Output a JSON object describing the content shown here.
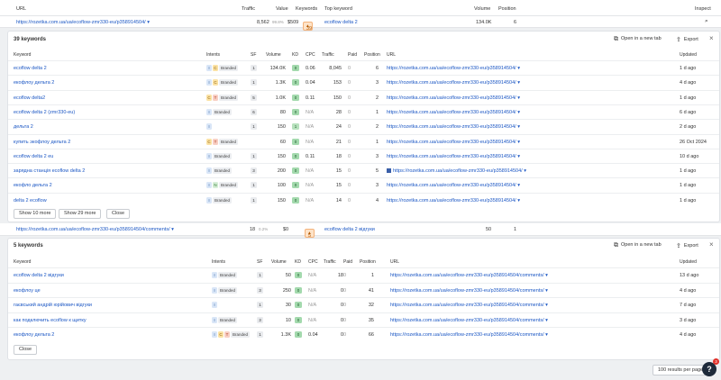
{
  "header": {
    "url": "URL",
    "traffic": "Traffic",
    "value": "Value",
    "keywords": "Keywords",
    "top_keyword": "Top keyword",
    "volume": "Volume",
    "position": "Position",
    "inspect": "Inspect"
  },
  "row1": {
    "url": "https://rozetka.com.ua/ua/ecoflow-zmr330-eu/p358914504/",
    "traffic": "8,562",
    "traffic_pct": "99.8%",
    "value": "$509",
    "keywords": "39",
    "top_keyword": "ecoflow delta 2",
    "volume": "134.0K",
    "position": "6"
  },
  "panel1": {
    "title": "39 keywords",
    "open_new_tab": "Open in a new tab",
    "export": "Export",
    "columns": [
      "Keyword",
      "Intents",
      "SF",
      "Volume",
      "KD",
      "CPC",
      "Traffic",
      "Paid",
      "Position",
      "URL",
      "Updated"
    ],
    "rows": [
      {
        "kw": "ecoflow delta 2",
        "intents": [
          "I",
          "C"
        ],
        "branded": "Branded",
        "sf": "1",
        "vol": "134.0K",
        "kd": "0",
        "cpc": "0.06",
        "traffic": "8,045",
        "paid": "0",
        "pos": "6",
        "url": "https://rozetka.com.ua/ua/ecoflow-zmr330-eu/p358914504/",
        "updated": "1 d ago"
      },
      {
        "kw": "екофлоу дельта 2",
        "intents": [
          "I",
          "C"
        ],
        "branded": "Branded",
        "sf": "1",
        "vol": "1.3K",
        "kd": "0",
        "cpc": "0.04",
        "traffic": "153",
        "paid": "0",
        "pos": "3",
        "url": "https://rozetka.com.ua/ua/ecoflow-zmr330-eu/p358914504/",
        "updated": "4 d ago"
      },
      {
        "kw": "ecoflow delta2",
        "intents": [
          "C",
          "T"
        ],
        "branded": "Branded",
        "sf": "5",
        "vol": "1.0K",
        "kd": "0",
        "cpc": "0.11",
        "traffic": "150",
        "paid": "0",
        "pos": "2",
        "url": "https://rozetka.com.ua/ua/ecoflow-zmr330-eu/p358914504/",
        "updated": "1 d ago"
      },
      {
        "kw": "ecoflow delta 2 (zmr330-eu)",
        "intents": [
          "I"
        ],
        "branded": "Branded",
        "sf": "6",
        "vol": "80",
        "kd": "0",
        "cpc": "N/A",
        "traffic": "28",
        "paid": "0",
        "pos": "1",
        "url": "https://rozetka.com.ua/ua/ecoflow-zmr330-eu/p358914504/",
        "updated": "6 d ago"
      },
      {
        "kw": "дельта 2",
        "intents": [
          "I"
        ],
        "branded": "",
        "sf": "1",
        "vol": "150",
        "kd": "1",
        "cpc": "N/A",
        "traffic": "24",
        "paid": "0",
        "pos": "2",
        "url": "https://rozetka.com.ua/ua/ecoflow-zmr330-eu/p358914504/",
        "updated": "2 d ago"
      },
      {
        "kw": "купить экофлоу дельта 2",
        "intents": [
          "C",
          "T"
        ],
        "branded": "Branded",
        "sf": "",
        "vol": "60",
        "kd": "0",
        "cpc": "N/A",
        "traffic": "21",
        "paid": "0",
        "pos": "1",
        "url": "https://rozetka.com.ua/ua/ecoflow-zmr330-eu/p358914504/",
        "updated": "26 Oct 2024"
      },
      {
        "kw": "ecoflow delta 2 eu",
        "intents": [
          "I"
        ],
        "branded": "Branded",
        "sf": "1",
        "vol": "150",
        "kd": "0",
        "cpc": "0.11",
        "traffic": "18",
        "paid": "0",
        "pos": "3",
        "url": "https://rozetka.com.ua/ua/ecoflow-zmr330-eu/p358914504/",
        "updated": "10 d ago"
      },
      {
        "kw": "зарядна станція ecoflow delta 2",
        "intents": [
          "I"
        ],
        "branded": "Branded",
        "sf": "3",
        "vol": "200",
        "kd": "0",
        "cpc": "N/A",
        "traffic": "15",
        "paid": "0",
        "pos": "5",
        "url": "https://rozetka.com.ua/ua/ecoflow-zmr330-eu/p358914504/",
        "updated": "1 d ago",
        "url_icon": true
      },
      {
        "kw": "екофло дельта 2",
        "intents": [
          "I",
          "N"
        ],
        "branded": "Branded",
        "sf": "1",
        "vol": "100",
        "kd": "0",
        "cpc": "N/A",
        "traffic": "15",
        "paid": "0",
        "pos": "3",
        "url": "https://rozetka.com.ua/ua/ecoflow-zmr330-eu/p358914504/",
        "updated": "1 d ago"
      },
      {
        "kw": "delta 2 ecoflow",
        "intents": [
          "I"
        ],
        "branded": "Branded",
        "sf": "1",
        "vol": "150",
        "kd": "0",
        "cpc": "N/A",
        "traffic": "14",
        "paid": "0",
        "pos": "4",
        "url": "https://rozetka.com.ua/ua/ecoflow-zmr330-eu/p358914504/",
        "updated": "1 d ago"
      }
    ],
    "btn_show10": "Show 10 more",
    "btn_show29": "Show 29 more",
    "btn_close": "Close"
  },
  "row2": {
    "url": "https://rozetka.com.ua/ua/ecoflow-zmr330-eu/p358914504/comments/",
    "traffic": "18",
    "traffic_pct": "0.2%",
    "value": "$0",
    "keywords": "5",
    "top_keyword": "ecoflow delta 2 відгуки",
    "volume": "50",
    "position": "1"
  },
  "panel2": {
    "title": "5 keywords",
    "open_new_tab": "Open in a new tab",
    "export": "Export",
    "columns": [
      "Keyword",
      "Intents",
      "SF",
      "Volume",
      "KD",
      "CPC",
      "Traffic",
      "Paid",
      "Position",
      "URL",
      "Updated"
    ],
    "rows": [
      {
        "kw": "ecoflow delta 2 відгуки",
        "intents": [
          "I"
        ],
        "branded": "Branded",
        "sf": "1",
        "vol": "50",
        "kd": "0",
        "cpc": "N/A",
        "traffic": "18",
        "paid": "0",
        "pos": "1",
        "url": "https://rozetka.com.ua/ua/ecoflow-zmr330-eu/p358914504/comments/",
        "updated": "13 d ago"
      },
      {
        "kw": "екофлоу це",
        "intents": [
          "I"
        ],
        "branded": "Branded",
        "sf": "3",
        "vol": "250",
        "kd": "0",
        "cpc": "N/A",
        "traffic": "0",
        "paid": "0",
        "pos": "41",
        "url": "https://rozetka.com.ua/ua/ecoflow-zmr330-eu/p358914504/comments/",
        "updated": "4 d ago"
      },
      {
        "kw": "гаєвський андрій юрійович відгуки",
        "intents": [
          "I"
        ],
        "branded": "",
        "sf": "1",
        "vol": "30",
        "kd": "0",
        "cpc": "N/A",
        "traffic": "0",
        "paid": "0",
        "pos": "32",
        "url": "https://rozetka.com.ua/ua/ecoflow-zmr330-eu/p358914504/comments/",
        "updated": "7 d ago"
      },
      {
        "kw": "как подключить ecoflow к щитку",
        "intents": [
          "I"
        ],
        "branded": "Branded",
        "sf": "3",
        "vol": "10",
        "kd": "0",
        "cpc": "N/A",
        "traffic": "0",
        "paid": "0",
        "pos": "35",
        "url": "https://rozetka.com.ua/ua/ecoflow-zmr330-eu/p358914504/comments/",
        "updated": "3 d ago"
      },
      {
        "kw": "екофлоу дельта 2",
        "intents": [
          "I",
          "C",
          "T"
        ],
        "branded": "Branded",
        "sf": "1",
        "vol": "1.3K",
        "kd": "0",
        "cpc": "0.04",
        "traffic": "0",
        "paid": "0",
        "pos": "66",
        "url": "https://rozetka.com.ua/ua/ecoflow-zmr330-eu/p358914504/comments/",
        "updated": "4 d ago"
      }
    ],
    "btn_close": "Close"
  },
  "footer": {
    "per_page": "100 results per page",
    "help_badge": "3",
    "help": "?"
  }
}
